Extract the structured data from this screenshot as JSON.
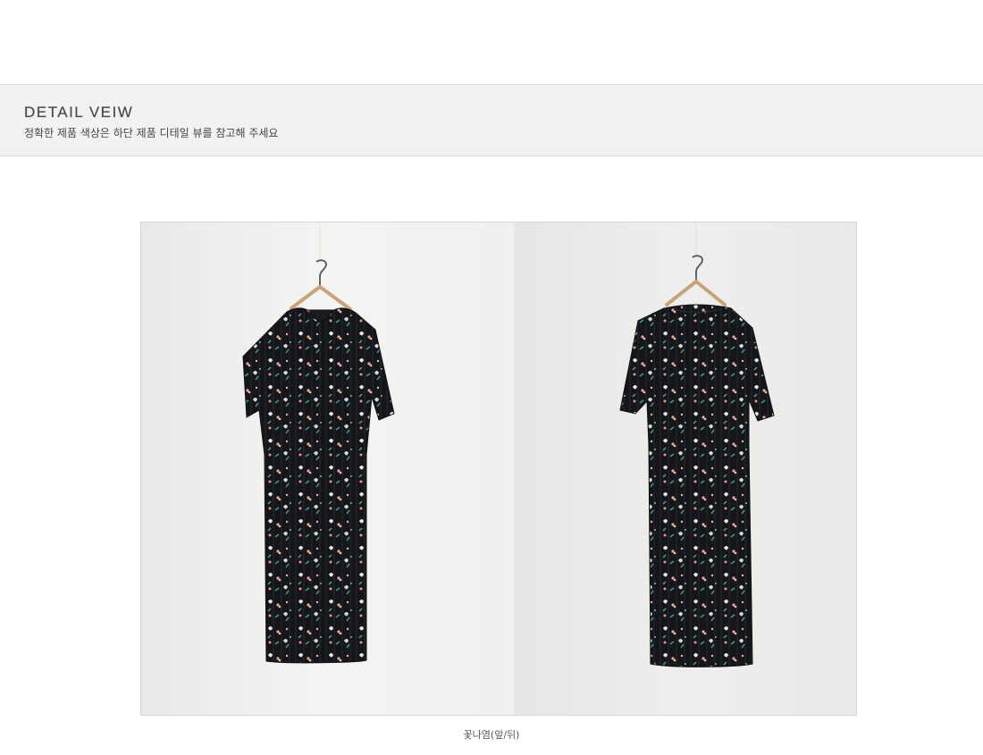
{
  "detail": {
    "title": "DETAIL VEIW",
    "subtitle": "정확한 제품 색상은 하단 제품 디테일 뷰를 참고해 주세요"
  },
  "photo": {
    "caption": "꽃나염(앞/뒤)"
  },
  "colors": {
    "band": "#f2f2f2",
    "wall": "#ececea",
    "dress": "#15161a"
  }
}
